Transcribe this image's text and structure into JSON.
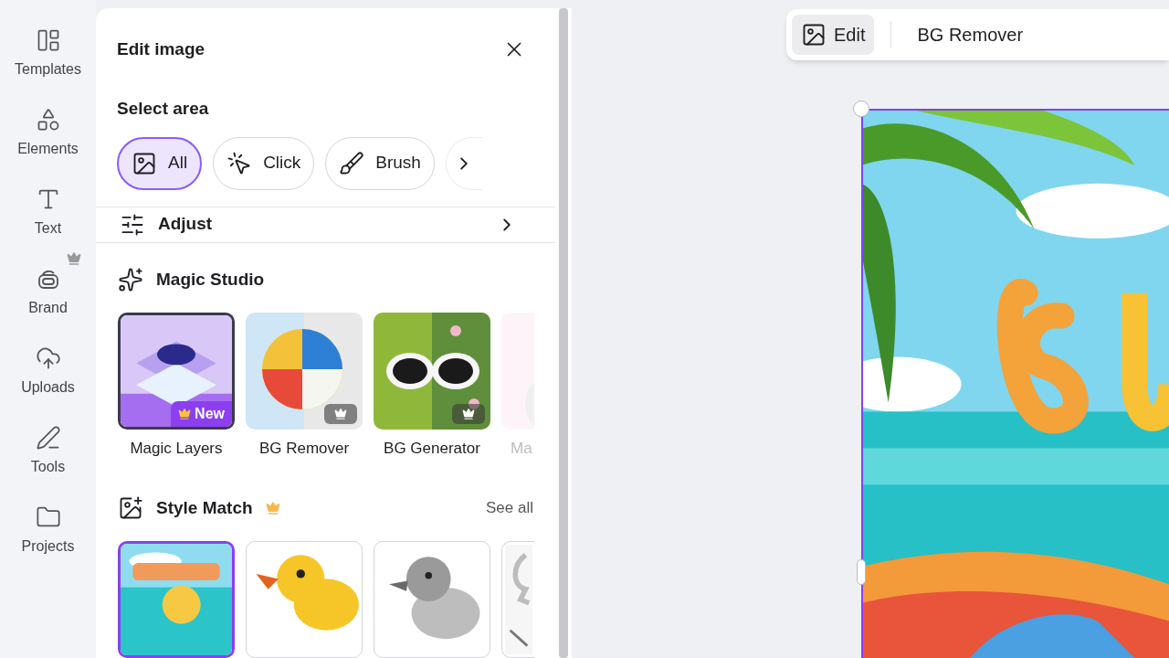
{
  "sidebar": {
    "items": [
      {
        "label": "Templates",
        "premium": false
      },
      {
        "label": "Elements",
        "premium": false
      },
      {
        "label": "Text",
        "premium": false
      },
      {
        "label": "Brand",
        "premium": true
      },
      {
        "label": "Uploads",
        "premium": false
      },
      {
        "label": "Tools",
        "premium": false
      },
      {
        "label": "Projects",
        "premium": false
      }
    ]
  },
  "panel": {
    "title": "Edit image",
    "select_area": {
      "label": "Select area",
      "options": [
        {
          "label": "All",
          "selected": true
        },
        {
          "label": "Click",
          "selected": false
        },
        {
          "label": "Brush",
          "selected": false
        }
      ]
    },
    "adjust": {
      "label": "Adjust"
    },
    "magic_studio": {
      "title": "Magic Studio",
      "items": [
        {
          "label": "Magic Layers",
          "badge": "New",
          "premium": true,
          "faded": false
        },
        {
          "label": "BG Remover",
          "premium": true,
          "faded": false
        },
        {
          "label": "BG Generator",
          "premium": true,
          "faded": false
        },
        {
          "label": "Ma",
          "premium": false,
          "faded": true
        }
      ]
    },
    "style_match": {
      "title": "Style Match",
      "premium": true,
      "link": "See all",
      "thumbnails": [
        {
          "selected": true
        },
        {
          "selected": false
        },
        {
          "selected": false
        },
        {
          "selected": false
        }
      ]
    }
  },
  "toolbar": {
    "items": [
      {
        "label": "Edit",
        "selected": true
      },
      {
        "label": "BG Remover",
        "selected": false
      }
    ]
  }
}
